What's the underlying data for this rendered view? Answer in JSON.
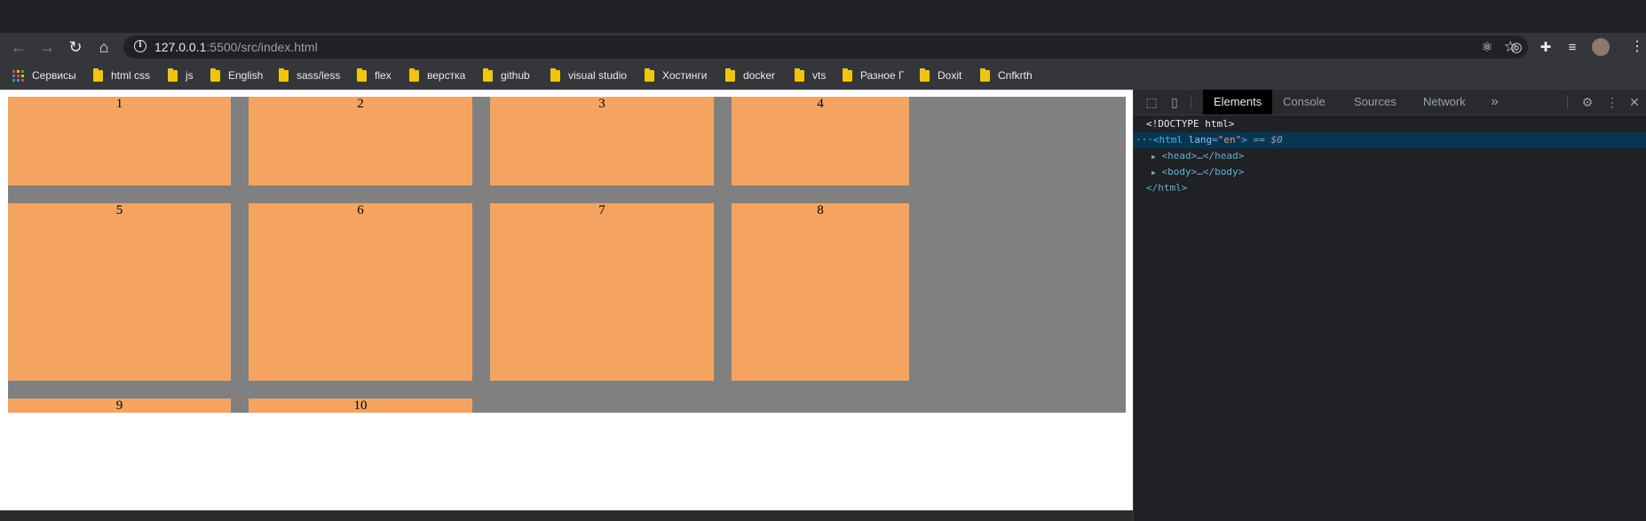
{
  "browser": {
    "url_host": "127.0.0.1",
    "url_rest": ":5500/src/index.html"
  },
  "bookmarks": [
    {
      "label": "Сервисы",
      "icon": "apps-icon"
    },
    {
      "label": "html css",
      "icon": "folder-icon"
    },
    {
      "label": "js",
      "icon": "folder-icon"
    },
    {
      "label": "English",
      "icon": "folder-icon"
    },
    {
      "label": "sass/less",
      "icon": "folder-icon"
    },
    {
      "label": "flex",
      "icon": "folder-icon"
    },
    {
      "label": "верстка",
      "icon": "folder-icon"
    },
    {
      "label": "github",
      "icon": "folder-icon"
    },
    {
      "label": "visual studio",
      "icon": "folder-icon"
    },
    {
      "label": "Хостинги",
      "icon": "folder-icon"
    },
    {
      "label": "docker",
      "icon": "folder-icon"
    },
    {
      "label": "vts",
      "icon": "folder-icon"
    },
    {
      "label": "Разное Г",
      "icon": "folder-icon"
    },
    {
      "label": "Doxit",
      "icon": "folder-icon"
    },
    {
      "label": "Cnfkrth",
      "icon": "folder-icon"
    }
  ],
  "page": {
    "cells": [
      "1",
      "2",
      "3",
      "4",
      "5",
      "6",
      "7",
      "8",
      "9",
      "10"
    ],
    "colors": {
      "container": "#808080",
      "cell": "#f4a460",
      "page_bg": "#ffffff"
    }
  },
  "devtools": {
    "tabs": [
      "Elements",
      "Console",
      "Sources",
      "Network"
    ],
    "active_tab": "Elements",
    "more_tabs": "»",
    "dom": {
      "doctype": "<!DOCTYPE html>",
      "html_open_tag": "<html",
      "lang_attr": "lang",
      "lang_val": "\"en\"",
      "html_open_close": ">",
      "selected_marker": "== $0",
      "ellipsis_marker": "···",
      "head_open": "<head>",
      "head_close": "</head>",
      "body_open": "<body>",
      "body_close": "</body>",
      "html_close": "</html>",
      "collapsed": "…"
    }
  }
}
